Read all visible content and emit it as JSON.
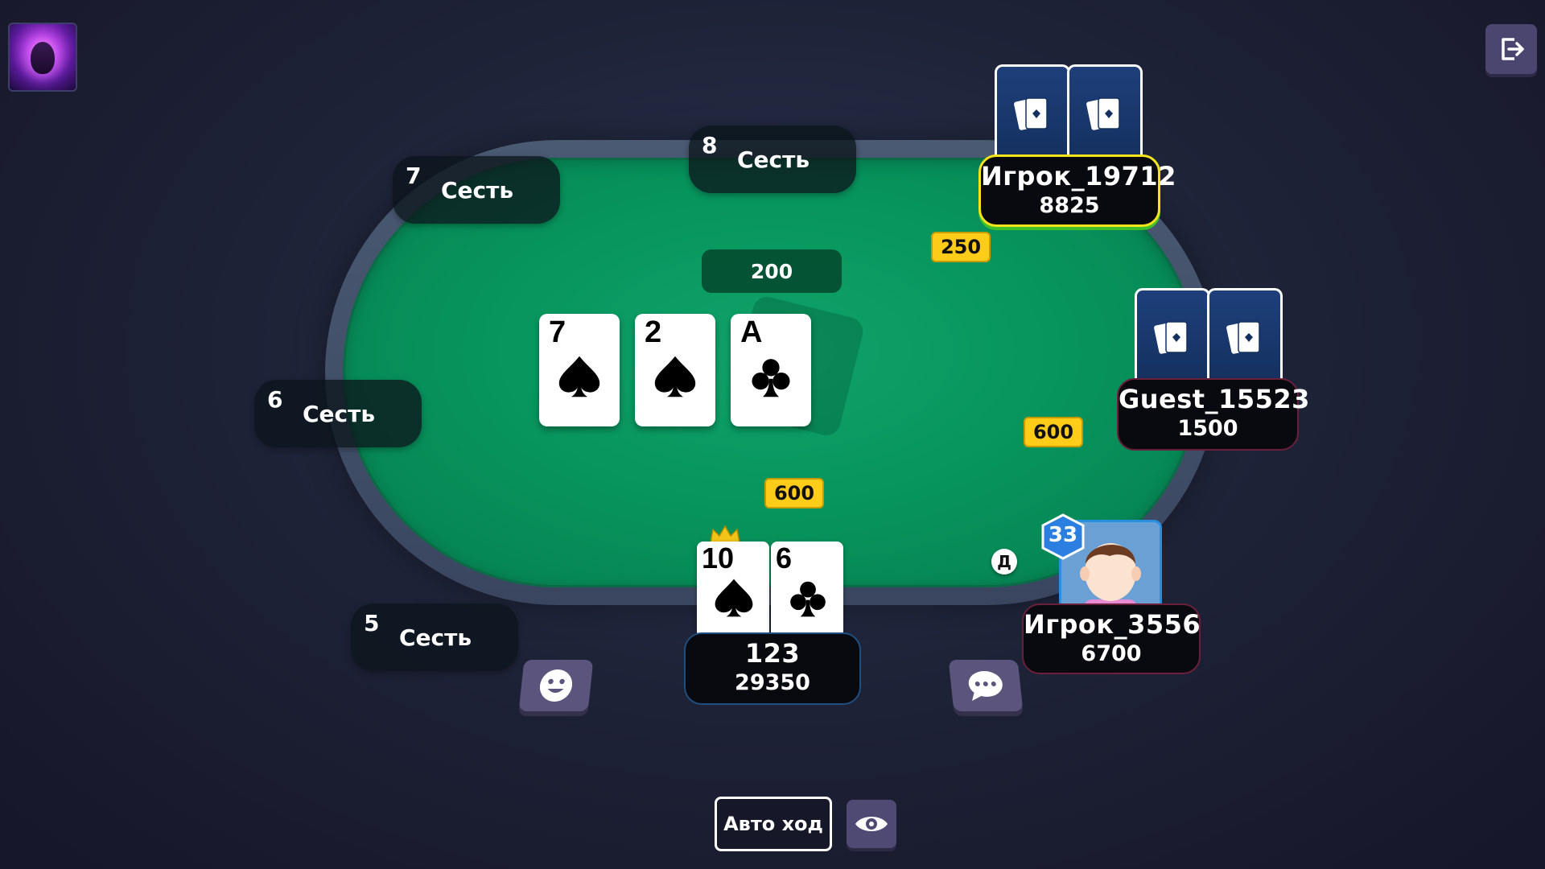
{
  "header": {
    "avatar_icon": "player-avatar",
    "exit_icon": "exit-icon"
  },
  "seats": [
    {
      "num": "7",
      "label": "Сесть"
    },
    {
      "num": "8",
      "label": "Сесть"
    },
    {
      "num": "6",
      "label": "Сесть"
    },
    {
      "num": "5",
      "label": "Сесть"
    }
  ],
  "pot": "200",
  "community_cards": [
    {
      "rank": "7",
      "suit": "spade"
    },
    {
      "rank": "2",
      "suit": "spade"
    },
    {
      "rank": "A",
      "suit": "club"
    }
  ],
  "players": {
    "top_right": {
      "name": "Игрок_19712",
      "chips": "8825",
      "bet": "250",
      "highlight": "#f5e31c"
    },
    "right": {
      "name": "Guest_15523",
      "chips": "1500",
      "bet": "600"
    },
    "bottom_right": {
      "name": "Игрок_3556",
      "chips": "6700",
      "level": "33"
    },
    "me": {
      "name": "123",
      "chips": "29350",
      "bet": "600",
      "cards": [
        {
          "rank": "10",
          "suit": "spade"
        },
        {
          "rank": "6",
          "suit": "club"
        }
      ]
    }
  },
  "dealer_label": "Д",
  "controls": {
    "auto_label": "Авто ход",
    "emoji_icon": "smiley-icon",
    "chat_icon": "chat-icon",
    "eye_icon": "eye-icon"
  },
  "colors": {
    "felt": "#07935c",
    "bet_chip": "#ffcc1a",
    "plate": "#090a0f",
    "button": "#5b557d"
  }
}
